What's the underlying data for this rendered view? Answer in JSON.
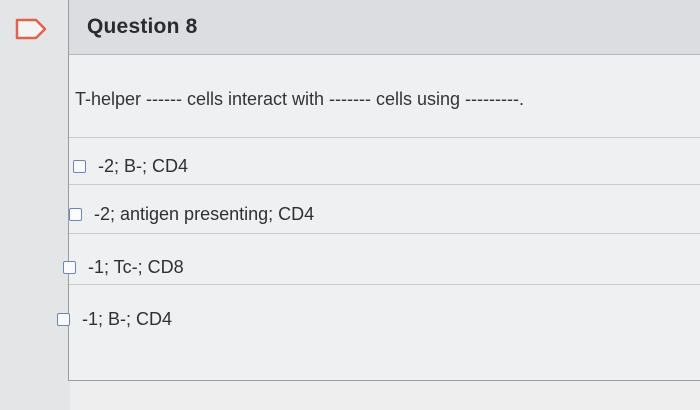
{
  "question": {
    "title": "Question 8",
    "prompt": "T-helper ------ cells interact with ------- cells using ---------."
  },
  "options": [
    {
      "label": "-2; B-; CD4",
      "checked": false
    },
    {
      "label": "-2; antigen presenting; CD4",
      "checked": false
    },
    {
      "label": "-1; Tc-; CD8",
      "checked": false
    },
    {
      "label": "-1; B-; CD4",
      "checked": false
    }
  ],
  "icons": {
    "flag": "flag-icon"
  },
  "colors": {
    "checkbox_border": "#6b87b8",
    "flag_outline": "#e0624d"
  }
}
